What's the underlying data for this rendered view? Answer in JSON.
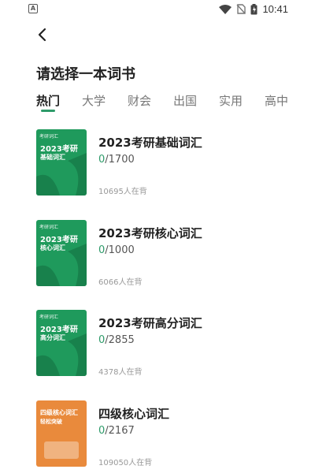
{
  "status_bar": {
    "time": "10:41",
    "left_icon": "A"
  },
  "header": {
    "title": "请选择一本词书"
  },
  "tabs": [
    {
      "label": "热门",
      "active": true
    },
    {
      "label": "大学",
      "active": false
    },
    {
      "label": "财会",
      "active": false
    },
    {
      "label": "出国",
      "active": false
    },
    {
      "label": "实用",
      "active": false
    },
    {
      "label": "高中",
      "active": false
    }
  ],
  "colors": {
    "accent": "#2e9b6a",
    "cover_green": "#1f9a5c",
    "cover_orange": "#e98a3c"
  },
  "books": [
    {
      "title": "2023考研基础词汇",
      "done": "0",
      "total": "/1700",
      "learners": "10695人在背",
      "cover_color": "#1f9a5c",
      "cover_badge": "考研词汇",
      "cover_line1": "2023考研",
      "cover_line2": "基础词汇"
    },
    {
      "title": "2023考研核心词汇",
      "done": "0",
      "total": "/1000",
      "learners": "6066人在背",
      "cover_color": "#1f9a5c",
      "cover_badge": "考研词汇",
      "cover_line1": "2023考研",
      "cover_line2": "核心词汇"
    },
    {
      "title": "2023考研高分词汇",
      "done": "0",
      "total": "/2855",
      "learners": "4378人在背",
      "cover_color": "#1f9a5c",
      "cover_badge": "考研词汇",
      "cover_line1": "2023考研",
      "cover_line2": "高分词汇"
    },
    {
      "title": "四级核心词汇",
      "done": "0",
      "total": "/2167",
      "learners": "109050人在背",
      "cover_color": "#e98a3c",
      "cover_badge": "",
      "cover_line1": "四级核心词汇",
      "cover_line2": "轻松突破"
    }
  ]
}
